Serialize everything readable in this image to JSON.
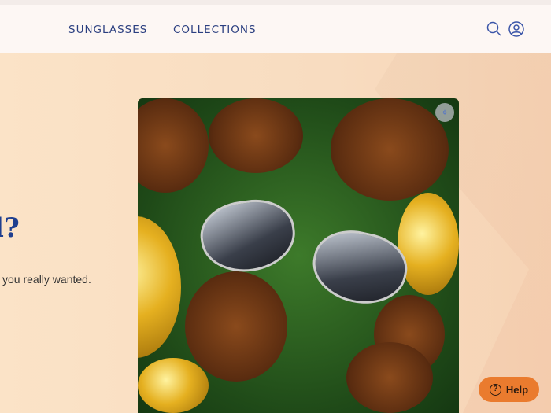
{
  "nav": {
    "items": [
      {
        "label": "SUNGLASSES"
      },
      {
        "label": "COLLECTIONS"
      }
    ],
    "icons": [
      "search-icon",
      "account-icon"
    ]
  },
  "hero": {
    "heading": "l?",
    "subtext": "you really wanted."
  },
  "image": {
    "scan_icon": "visual-search-icon"
  },
  "help": {
    "label": "Help",
    "icon": "?"
  },
  "colors": {
    "nav_text": "#2b3f80",
    "heading": "#1f3f8f",
    "help_bg": "#ea7b2e"
  }
}
